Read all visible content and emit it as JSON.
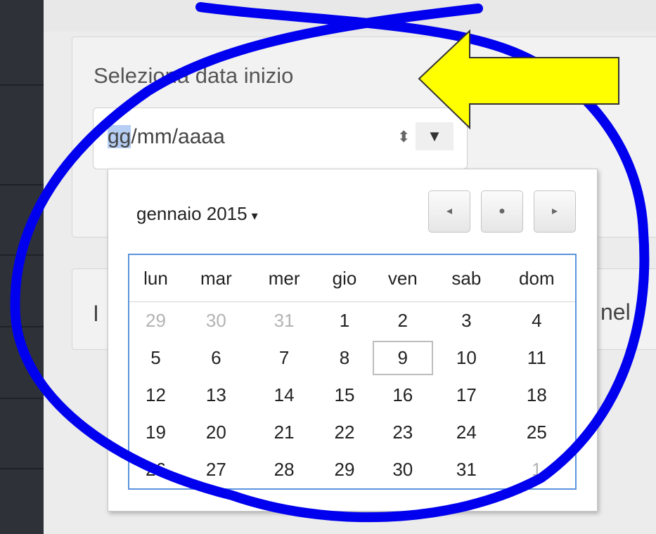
{
  "form": {
    "label": "Seleziona data inizio",
    "date_input": {
      "selected_segment": "gg",
      "rest_of_value": "/mm/aaaa",
      "spinner_symbol": "⬍",
      "dropdown_symbol": "▼"
    },
    "peek_left": "I",
    "peek_right": "nel"
  },
  "picker": {
    "month_label": "gennaio 2015",
    "month_caret": "▾",
    "nav": {
      "prev": "◂",
      "today": "●",
      "next": "▸"
    },
    "weekdays": [
      "lun",
      "mar",
      "mer",
      "gio",
      "ven",
      "sab",
      "dom"
    ],
    "weeks": [
      [
        {
          "d": "29",
          "dim": true
        },
        {
          "d": "30",
          "dim": true
        },
        {
          "d": "31",
          "dim": true
        },
        {
          "d": "1"
        },
        {
          "d": "2"
        },
        {
          "d": "3"
        },
        {
          "d": "4"
        }
      ],
      [
        {
          "d": "5"
        },
        {
          "d": "6"
        },
        {
          "d": "7"
        },
        {
          "d": "8"
        },
        {
          "d": "9",
          "today": true
        },
        {
          "d": "10"
        },
        {
          "d": "11"
        }
      ],
      [
        {
          "d": "12"
        },
        {
          "d": "13"
        },
        {
          "d": "14"
        },
        {
          "d": "15"
        },
        {
          "d": "16"
        },
        {
          "d": "17"
        },
        {
          "d": "18"
        }
      ],
      [
        {
          "d": "19"
        },
        {
          "d": "20"
        },
        {
          "d": "21"
        },
        {
          "d": "22"
        },
        {
          "d": "23"
        },
        {
          "d": "24"
        },
        {
          "d": "25"
        }
      ],
      [
        {
          "d": "26"
        },
        {
          "d": "27"
        },
        {
          "d": "28"
        },
        {
          "d": "29"
        },
        {
          "d": "30"
        },
        {
          "d": "31"
        },
        {
          "d": "1",
          "dim": true
        }
      ]
    ]
  },
  "annotation": {
    "circle_color": "#0000ee",
    "arrow_color": "#ffff00"
  }
}
